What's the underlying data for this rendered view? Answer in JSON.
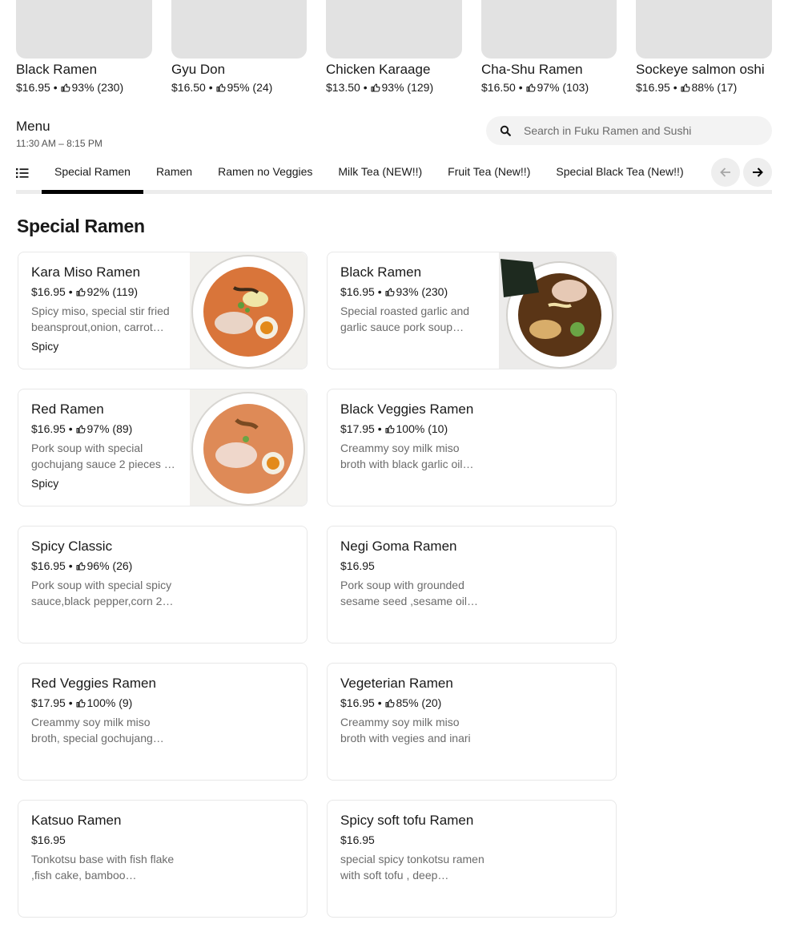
{
  "featured": [
    {
      "name": "Black Ramen",
      "price": "$16.95",
      "rating": "93% (230)"
    },
    {
      "name": "Gyu Don",
      "price": "$16.50",
      "rating": "95% (24)"
    },
    {
      "name": "Chicken Karaage",
      "price": "$13.50",
      "rating": "93% (129)"
    },
    {
      "name": "Cha-Shu Ramen",
      "price": "$16.50",
      "rating": "97% (103)"
    },
    {
      "name": "Sockeye salmon oshi",
      "price": "$16.95",
      "rating": "88% (17)"
    }
  ],
  "menu": {
    "title": "Menu",
    "hours": "11:30 AM – 8:15 PM",
    "search_placeholder": "Search in Fuku Ramen and Sushi"
  },
  "tabs": [
    {
      "label": "Special Ramen",
      "active": true
    },
    {
      "label": "Ramen"
    },
    {
      "label": "Ramen no Veggies"
    },
    {
      "label": "Milk Tea (NEW!!)"
    },
    {
      "label": "Fruit Tea (New!!)"
    },
    {
      "label": "Special Black Tea (New!!)"
    }
  ],
  "section_title": "Special Ramen",
  "separator": "•",
  "items": [
    {
      "name": "Kara Miso Ramen",
      "price": "$16.95",
      "rating": "92% (119)",
      "desc": "Spicy miso, special stir fried beansprout,onion, carrot…",
      "tag": "Spicy",
      "has_image": true
    },
    {
      "name": "Black Ramen",
      "price": "$16.95",
      "rating": "93% (230)",
      "desc": "Special roasted garlic and garlic sauce pork soup with…",
      "has_image": true
    },
    {
      "name": "Red Ramen",
      "price": "$16.95",
      "rating": "97% (89)",
      "desc": "Pork soup with special gochujang sauce 2 pieces …",
      "tag": "Spicy",
      "has_image": true
    },
    {
      "name": "Black Veggies Ramen",
      "price": "$17.95",
      "rating": "100% (10)",
      "desc": "Creammy soy milk miso broth with black garlic oil…"
    },
    {
      "name": "Spicy Classic",
      "price": "$16.95",
      "rating": "96% (26)",
      "desc": "Pork soup with special spicy sauce,black pepper,corn 2…"
    },
    {
      "name": "Negi Goma Ramen",
      "price": "$16.95",
      "desc": "Pork soup with grounded sesame seed ,sesame oil…"
    },
    {
      "name": "Red Veggies Ramen",
      "price": "$17.95",
      "rating": "100% (9)",
      "desc": "Creammy soy milk miso broth, special gochujang…"
    },
    {
      "name": "Vegeterian Ramen",
      "price": "$16.95",
      "rating": "85% (20)",
      "desc": "Creammy soy milk miso broth with vegies and inari"
    },
    {
      "name": "Katsuo Ramen",
      "price": "$16.95",
      "desc": "Tonkotsu base with fish flake ,fish cake, bamboo…"
    },
    {
      "name": "Spicy soft tofu Ramen",
      "price": "$16.95",
      "desc": "special spicy tonkotsu ramen with soft tofu , deep…"
    }
  ],
  "icons": {
    "thumb": "thumbs-up-icon",
    "search": "search-icon",
    "list": "list-icon",
    "prev": "arrow-left-icon",
    "next": "arrow-right-icon"
  }
}
